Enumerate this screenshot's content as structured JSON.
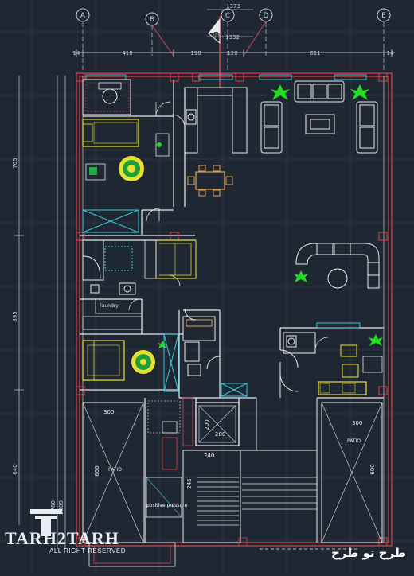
{
  "grid_axes": [
    "A",
    "B",
    "C",
    "D",
    "E"
  ],
  "top_dims": {
    "overall": "1373",
    "inner": "1332",
    "segments": [
      "14",
      "410",
      "190",
      "120",
      "611",
      "14"
    ]
  },
  "left_dims": {
    "vertical": [
      "705",
      "895",
      "640"
    ],
    "small": [
      "2760",
      "2809"
    ]
  },
  "section_marker": "B",
  "rooms": {
    "laundry": "laundry",
    "patio_left": "PATIO",
    "patio_right": "PATIO",
    "positive_pressure": "positive pressure",
    "patio_left_w": "300",
    "patio_left_h": "600",
    "patio_right_w": "300",
    "patio_right_h": "600",
    "shaft_w": "200",
    "shaft_h": "200",
    "stair_w": "240",
    "stair_h": "245"
  },
  "watermark": {
    "brand": "TARH2TARH",
    "tagline": "ALL RIGHT RESERVED",
    "persian": "طرح تو طرح"
  },
  "colors": {
    "background": "#1f2733",
    "wall": "#e0404a",
    "furniture": "#e8e8e8",
    "wood": "#e0a050",
    "cyan": "#36c8d8",
    "green": "#22dd22",
    "yellow": "#e8e030"
  }
}
